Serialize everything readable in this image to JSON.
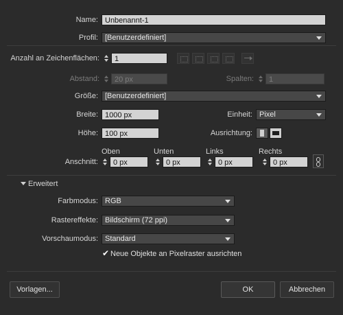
{
  "name": {
    "label": "Name:",
    "value": "Unbenannt-1"
  },
  "profile": {
    "label": "Profil:",
    "value": "[Benutzerdefiniert]"
  },
  "artboards": {
    "label": "Anzahl an Zeichenflächen:",
    "value": "1"
  },
  "spacing": {
    "label": "Abstand:",
    "value": "20 px"
  },
  "columns": {
    "label": "Spalten:",
    "value": "1"
  },
  "size": {
    "label": "Größe:",
    "value": "[Benutzerdefiniert]"
  },
  "width": {
    "label": "Breite:",
    "value": "1000 px"
  },
  "unit": {
    "label": "Einheit:",
    "value": "Pixel"
  },
  "height": {
    "label": "Höhe:",
    "value": "100 px"
  },
  "orientation": {
    "label": "Ausrichtung:"
  },
  "bleed": {
    "label": "Anschnitt:",
    "top_label": "Oben",
    "top_value": "0 px",
    "bottom_label": "Unten",
    "bottom_value": "0 px",
    "left_label": "Links",
    "left_value": "0 px",
    "right_label": "Rechts",
    "right_value": "0 px"
  },
  "advanced": {
    "label": "Erweitert"
  },
  "color_mode": {
    "label": "Farbmodus:",
    "value": "RGB"
  },
  "raster_effects": {
    "label": "Rastereffekte:",
    "value": "Bildschirm (72 ppi)"
  },
  "preview_mode": {
    "label": "Vorschaumodus:",
    "value": "Standard"
  },
  "pixel_grid": {
    "label": "Neue Objekte an Pixelraster ausrichten",
    "checked": true
  },
  "buttons": {
    "templates": "Vorlagen...",
    "ok": "OK",
    "cancel": "Abbrechen"
  },
  "icons": [
    "grid-by-row-icon",
    "grid-by-column-icon",
    "arrange-by-row-icon",
    "arrange-by-column-icon",
    "right-to-left-icon",
    "portrait-icon",
    "landscape-icon",
    "link-icon",
    "checkmark-icon"
  ],
  "colors": {
    "background": "#2b2b2b",
    "field": "#d3d3d3",
    "select": "#474747"
  }
}
